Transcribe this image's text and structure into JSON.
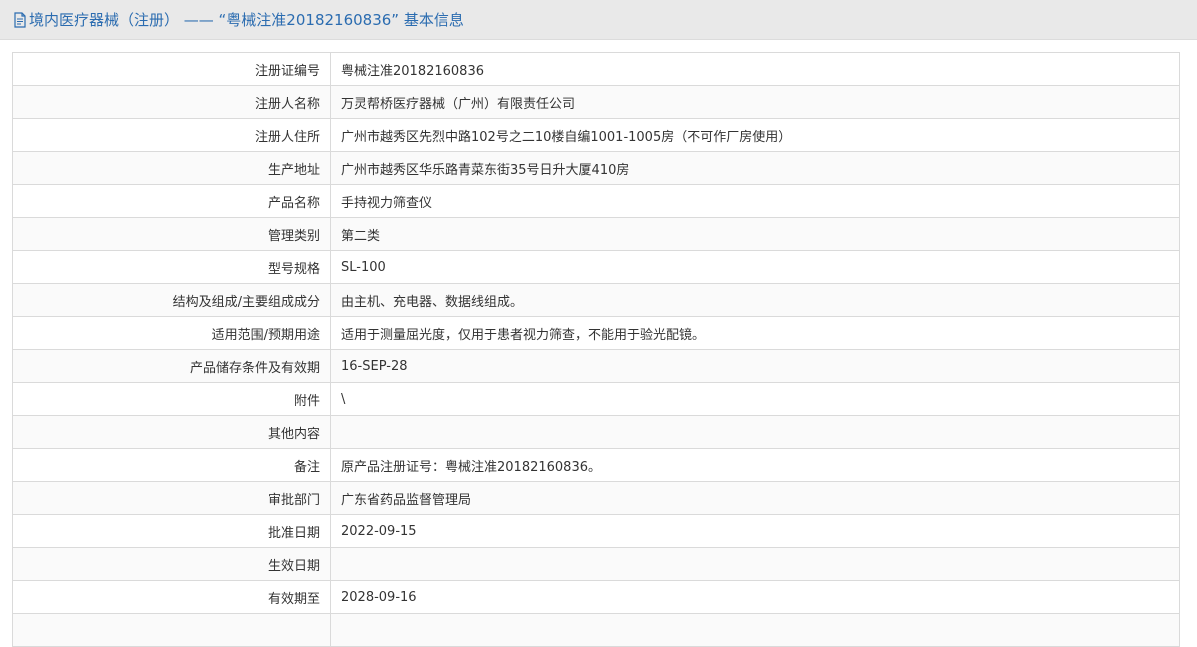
{
  "header": {
    "icon": "document-icon",
    "title": "境内医疗器械（注册） ——  “粤械注准20182160836” 基本信息",
    "accent_color": "#2b6cb0"
  },
  "rows": [
    {
      "label": "注册证编号",
      "value": "粤械注准20182160836"
    },
    {
      "label": "注册人名称",
      "value": "万灵帮桥医疗器械（广州）有限责任公司"
    },
    {
      "label": "注册人住所",
      "value": "广州市越秀区先烈中路102号之二10楼自编1001-1005房（不可作厂房使用）"
    },
    {
      "label": "生产地址",
      "value": "广州市越秀区华乐路青菜东街35号日升大厦410房"
    },
    {
      "label": "产品名称",
      "value": "手持视力筛查仪"
    },
    {
      "label": "管理类别",
      "value": "第二类"
    },
    {
      "label": "型号规格",
      "value": "SL-100"
    },
    {
      "label": "结构及组成/主要组成成分",
      "value": "由主机、充电器、数据线组成。"
    },
    {
      "label": "适用范围/预期用途",
      "value": "适用于测量屈光度，仅用于患者视力筛查，不能用于验光配镜。"
    },
    {
      "label": "产品储存条件及有效期",
      "value": "16-SEP-28"
    },
    {
      "label": "附件",
      "value": "\\"
    },
    {
      "label": "其他内容",
      "value": ""
    },
    {
      "label": "备注",
      "value": "原产品注册证号：粤械注准20182160836。"
    },
    {
      "label": "审批部门",
      "value": "广东省药品监督管理局"
    },
    {
      "label": "批准日期",
      "value": "2022-09-15"
    },
    {
      "label": "生效日期",
      "value": ""
    },
    {
      "label": "有效期至",
      "value": "2028-09-16"
    },
    {
      "label": "",
      "value": ""
    }
  ]
}
